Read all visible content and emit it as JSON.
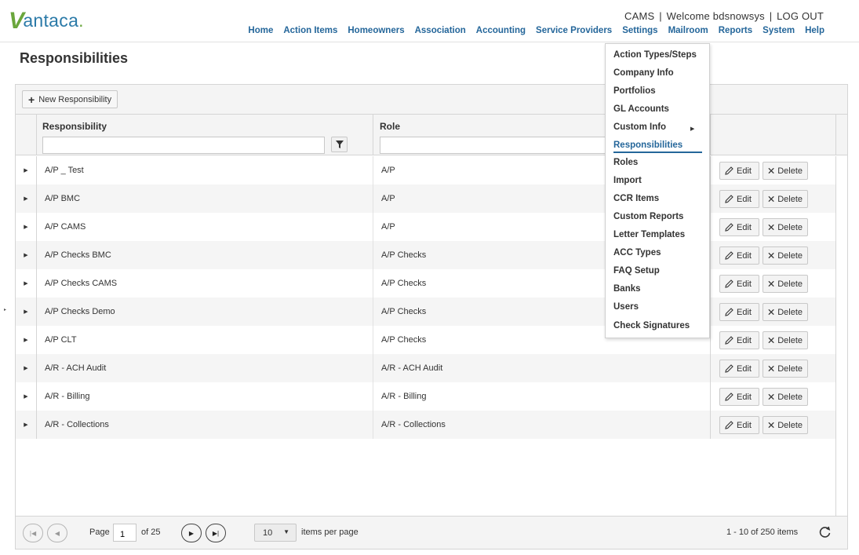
{
  "brand": {
    "name": "antaca",
    "initial": "V",
    "suffix": "."
  },
  "top_info": {
    "company": "CAMS",
    "sep": "|",
    "welcome": "Welcome bdsnowsys",
    "logout": "LOG OUT"
  },
  "nav": [
    "Home",
    "Action Items",
    "Homeowners",
    "Association",
    "Accounting",
    "Service Providers",
    "Settings",
    "Mailroom",
    "Reports",
    "System",
    "Help"
  ],
  "page_title": "Responsibilities",
  "toolbar": {
    "new_label": "New Responsibility"
  },
  "columns": {
    "responsibility": "Responsibility",
    "role": "Role"
  },
  "rows": [
    {
      "responsibility": "A/P _ Test",
      "role": "A/P"
    },
    {
      "responsibility": "A/P BMC",
      "role": "A/P"
    },
    {
      "responsibility": "A/P CAMS",
      "role": "A/P"
    },
    {
      "responsibility": "A/P Checks BMC",
      "role": "A/P Checks"
    },
    {
      "responsibility": "A/P Checks CAMS",
      "role": "A/P Checks"
    },
    {
      "responsibility": "A/P Checks Demo",
      "role": "A/P Checks"
    },
    {
      "responsibility": "A/P CLT",
      "role": "A/P Checks"
    },
    {
      "responsibility": "A/R - ACH Audit",
      "role": "A/R - ACH Audit"
    },
    {
      "responsibility": "A/R - Billing",
      "role": "A/R - Billing"
    },
    {
      "responsibility": "A/R - Collections",
      "role": "A/R - Collections"
    }
  ],
  "row_actions": {
    "edit": "Edit",
    "delete": "Delete"
  },
  "pager": {
    "page_label": "Page",
    "page_value": "1",
    "of_label": "of 25",
    "per_page_value": "10",
    "per_page_label": "items per page",
    "summary": "1 - 10 of 250 items"
  },
  "settings_menu": {
    "items": [
      "Action Types/Steps",
      "Company Info",
      "Portfolios",
      "GL Accounts",
      "Custom Info",
      "Responsibilities",
      "Roles",
      "Import",
      "CCR Items",
      "Custom Reports",
      "Letter Templates",
      "ACC Types",
      "FAQ Setup",
      "Banks",
      "Users",
      "Check Signatures"
    ],
    "active": "Responsibilities"
  },
  "colors": {
    "brand_blue": "#24669a",
    "brand_green": "#6aa63c",
    "border": "#d5d5d5"
  },
  "icons": {
    "new": "plus-icon",
    "filter": "filter-icon",
    "edit": "pencil-icon",
    "delete": "x-icon",
    "expand": "caret-right-icon",
    "refresh": "refresh-icon"
  }
}
